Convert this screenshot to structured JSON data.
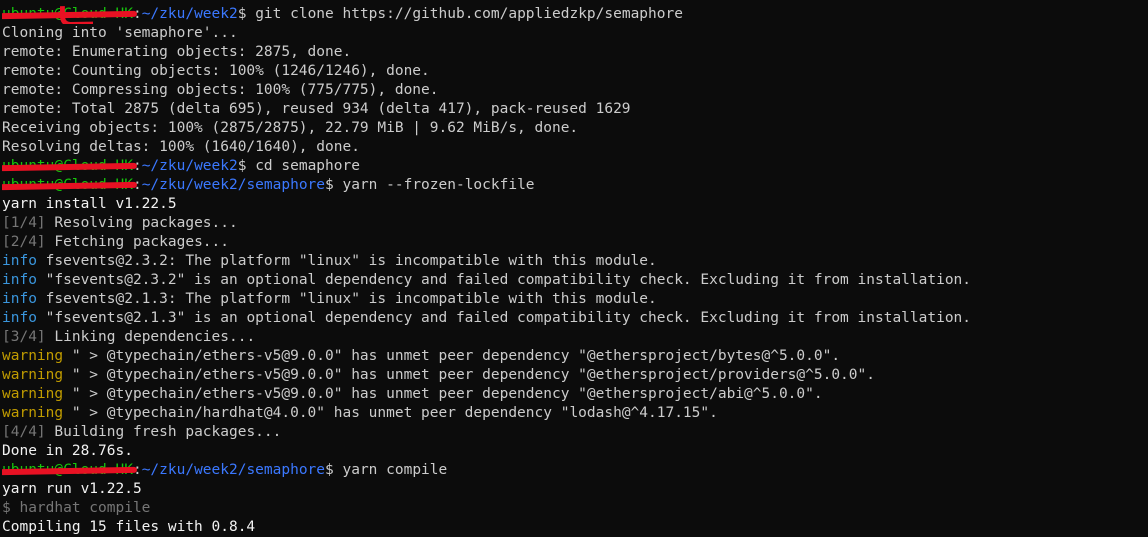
{
  "prompt_user": "ubuntu@Cloud-HK",
  "lines": [
    {
      "kind": "prompt",
      "cwd": "~/zku/week2",
      "cmd": "git clone https://github.com/appliedzkp/semaphore"
    },
    {
      "kind": "text",
      "text": "Cloning into 'semaphore'..."
    },
    {
      "kind": "text",
      "text": "remote: Enumerating objects: 2875, done."
    },
    {
      "kind": "text",
      "text": "remote: Counting objects: 100% (1246/1246), done."
    },
    {
      "kind": "text",
      "text": "remote: Compressing objects: 100% (775/775), done."
    },
    {
      "kind": "text",
      "text": "remote: Total 2875 (delta 695), reused 934 (delta 417), pack-reused 1629"
    },
    {
      "kind": "text",
      "text": "Receiving objects: 100% (2875/2875), 22.79 MiB | 9.62 MiB/s, done."
    },
    {
      "kind": "text",
      "text": "Resolving deltas: 100% (1640/1640), done."
    },
    {
      "kind": "prompt",
      "cwd": "~/zku/week2",
      "cmd": "cd semaphore"
    },
    {
      "kind": "prompt",
      "cwd": "~/zku/week2/semaphore",
      "cmd": "yarn --frozen-lockfile"
    },
    {
      "kind": "bright",
      "text": "yarn install v1.22.5"
    },
    {
      "kind": "step",
      "step": "[1/4]",
      "text": "Resolving packages..."
    },
    {
      "kind": "step",
      "step": "[2/4]",
      "text": "Fetching packages..."
    },
    {
      "kind": "info",
      "tag": "info",
      "text": "fsevents@2.3.2: The platform \"linux\" is incompatible with this module."
    },
    {
      "kind": "info",
      "tag": "info",
      "text": "\"fsevents@2.3.2\" is an optional dependency and failed compatibility check. Excluding it from installation."
    },
    {
      "kind": "info",
      "tag": "info",
      "text": "fsevents@2.1.3: The platform \"linux\" is incompatible with this module."
    },
    {
      "kind": "info",
      "tag": "info",
      "text": "\"fsevents@2.1.3\" is an optional dependency and failed compatibility check. Excluding it from installation."
    },
    {
      "kind": "step",
      "step": "[3/4]",
      "text": "Linking dependencies..."
    },
    {
      "kind": "warn",
      "tag": "warning",
      "text": "\" > @typechain/ethers-v5@9.0.0\" has unmet peer dependency \"@ethersproject/bytes@^5.0.0\"."
    },
    {
      "kind": "warn",
      "tag": "warning",
      "text": "\" > @typechain/ethers-v5@9.0.0\" has unmet peer dependency \"@ethersproject/providers@^5.0.0\"."
    },
    {
      "kind": "warn",
      "tag": "warning",
      "text": "\" > @typechain/ethers-v5@9.0.0\" has unmet peer dependency \"@ethersproject/abi@^5.0.0\"."
    },
    {
      "kind": "warn",
      "tag": "warning",
      "text": "\" > @typechain/hardhat@4.0.0\" has unmet peer dependency \"lodash@^4.17.15\"."
    },
    {
      "kind": "step",
      "step": "[4/4]",
      "text": "Building fresh packages..."
    },
    {
      "kind": "bright",
      "text": "Done in 28.76s."
    },
    {
      "kind": "prompt",
      "cwd": "~/zku/week2/semaphore",
      "cmd": "yarn compile"
    },
    {
      "kind": "bright",
      "text": "yarn run v1.22.5"
    },
    {
      "kind": "dim",
      "text": "$ hardhat compile"
    },
    {
      "kind": "bright",
      "text": "Compiling 15 files with 0.8.4"
    }
  ],
  "colors": {
    "background": "#0c0c0c",
    "foreground": "#cccccc",
    "user": "#16c60c",
    "path": "#3b78ff",
    "info": "#3a96dd",
    "warning": "#c19c00",
    "dim": "#767676",
    "redaction": "#e81123"
  }
}
